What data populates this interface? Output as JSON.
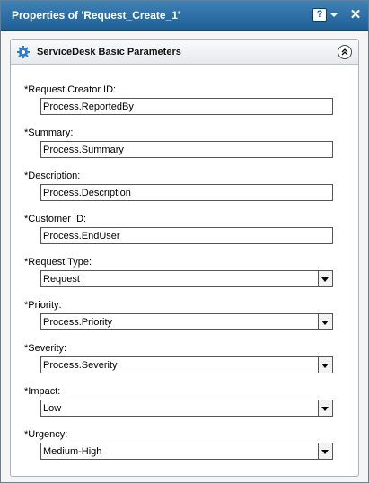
{
  "window": {
    "title": "Properties of 'Request_Create_1'",
    "help_glyph": "?",
    "close_glyph": "✕"
  },
  "panel": {
    "title": "ServiceDesk Basic Parameters"
  },
  "fields": {
    "request_creator": {
      "label": "*Request Creator ID:",
      "value": "Process.ReportedBy"
    },
    "summary": {
      "label": "*Summary:",
      "value": "Process.Summary"
    },
    "description": {
      "label": "*Description:",
      "value": "Process.Description"
    },
    "customer": {
      "label": "*Customer ID:",
      "value": "Process.EndUser"
    },
    "request_type": {
      "label": "*Request Type:",
      "value": "Request"
    },
    "priority": {
      "label": "*Priority:",
      "value": "Process.Priority"
    },
    "severity": {
      "label": "*Severity:",
      "value": "Process.Severity"
    },
    "impact": {
      "label": "*Impact:",
      "value": "Low"
    },
    "urgency": {
      "label": "*Urgency:",
      "value": "Medium-High"
    }
  },
  "icons": {
    "panel": "gear-icon",
    "collapse": "chevron-up-icon",
    "help": "help-icon",
    "close": "close-icon"
  },
  "colors": {
    "titlebar": "#2a6ca3",
    "panel_border": "#a9b3bc"
  }
}
